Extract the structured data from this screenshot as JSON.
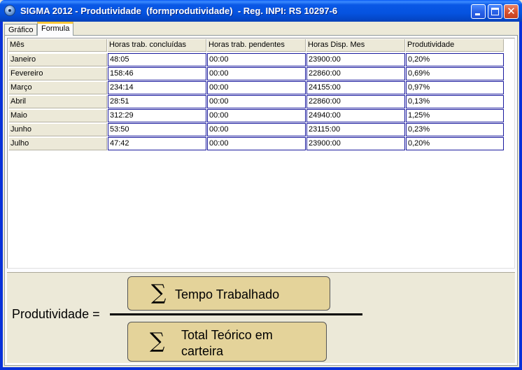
{
  "window": {
    "title": "SIGMA 2012 - Produtividade  (formprodutividade)  - Reg. INPI: RS 10297-6",
    "close_glyph": "✕"
  },
  "tabs": [
    {
      "label": "Gráfico",
      "active": false
    },
    {
      "label": "Formula",
      "active": true
    }
  ],
  "table": {
    "columns": [
      "Mês",
      "Horas trab. concluídas",
      "Horas trab. pendentes",
      "Horas Disp. Mes",
      "Produtividade"
    ],
    "rows": [
      [
        "Janeiro",
        "48:05",
        "00:00",
        "23900:00",
        "0,20%"
      ],
      [
        "Fevereiro",
        "158:46",
        "00:00",
        "22860:00",
        "0,69%"
      ],
      [
        "Março",
        "234:14",
        "00:00",
        "24155:00",
        "0,97%"
      ],
      [
        "Abril",
        "28:51",
        "00:00",
        "22860:00",
        "0,13%"
      ],
      [
        "Maio",
        "312:29",
        "00:00",
        "24940:00",
        "1,25%"
      ],
      [
        "Junho",
        "53:50",
        "00:00",
        "23115:00",
        "0,23%"
      ],
      [
        "Julho",
        "47:42",
        "00:00",
        "23900:00",
        "0,20%"
      ]
    ]
  },
  "formula": {
    "label": "Produtividade =",
    "sigma": "∑",
    "numerator": "Tempo Trabalhado",
    "denominator": "Total Teórico em carteira"
  },
  "colors": {
    "titlebar": "#0553e0",
    "formula_box": "#e4d39a",
    "cell_border": "#1a1a9e",
    "active_tab_accent": "#ffc83c"
  }
}
